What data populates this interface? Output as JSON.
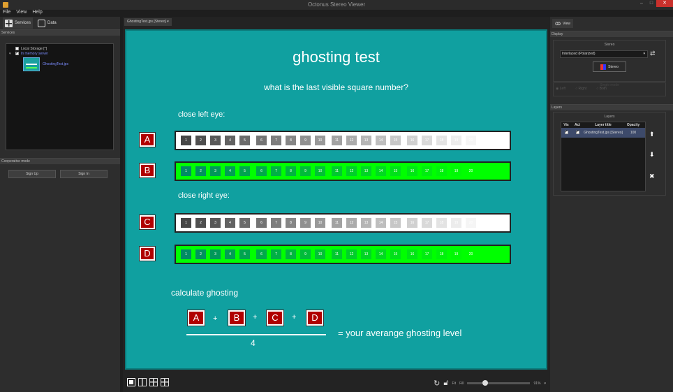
{
  "window": {
    "title": "Octonus Stereo Viewer",
    "minimize": "–",
    "maximize": "□",
    "close": "✕"
  },
  "menu": [
    "File",
    "View",
    "Help"
  ],
  "left_panel": {
    "tabs": [
      {
        "label": "Services",
        "icon": "services-icon"
      },
      {
        "label": "Data",
        "icon": "printer-icon"
      }
    ],
    "services_header": "Services",
    "tree": [
      {
        "label": "Local Storage [*]",
        "checked": false
      },
      {
        "label": "In memory server",
        "checked": true,
        "color": "#7b8cff"
      }
    ],
    "thumbnail_label": "GhostingTest.jps",
    "coop_header": "Cooperative mode",
    "sign_up": "Sign Up",
    "sign_in": "Sign In"
  },
  "doc_tab": "GhostingTest.jps [Stereo] ▾",
  "image": {
    "title": "ghosting test",
    "question": "what is the last visible square number?",
    "left_eye": "close left eye:",
    "right_eye": "close right eye:",
    "badges": [
      "A",
      "B",
      "C",
      "D"
    ],
    "squares": [
      "1",
      "2",
      "3",
      "4",
      "5",
      "6",
      "7",
      "8",
      "9",
      "10",
      "11",
      "12",
      "13",
      "14",
      "15",
      "16",
      "17",
      "18",
      "19",
      "20"
    ],
    "calc_label": "calculate ghosting",
    "plus": "+",
    "denominator": "4",
    "result": "= your averange ghosting level"
  },
  "status_bar": {
    "fit": "Fit",
    "fill": "Fill",
    "zoom": "91%",
    "zoom_fraction": 0.28
  },
  "right_panel": {
    "tab": "View",
    "display_header": "Display",
    "stereo_group": "Stereo",
    "mode": "Interlaced (Polarized)",
    "stereo_button": "Stereo",
    "single_mode_label": "Single mode",
    "radios": [
      "Left",
      "Right",
      "Both"
    ],
    "layers_header": "Layers",
    "layers_group": "Layers",
    "columns": [
      "Vis",
      "Act",
      "Layer title",
      "Opacity"
    ],
    "rows": [
      {
        "vis": true,
        "act": true,
        "title": "GhostingTest.jps [Stereo]",
        "opacity": "100"
      }
    ]
  }
}
